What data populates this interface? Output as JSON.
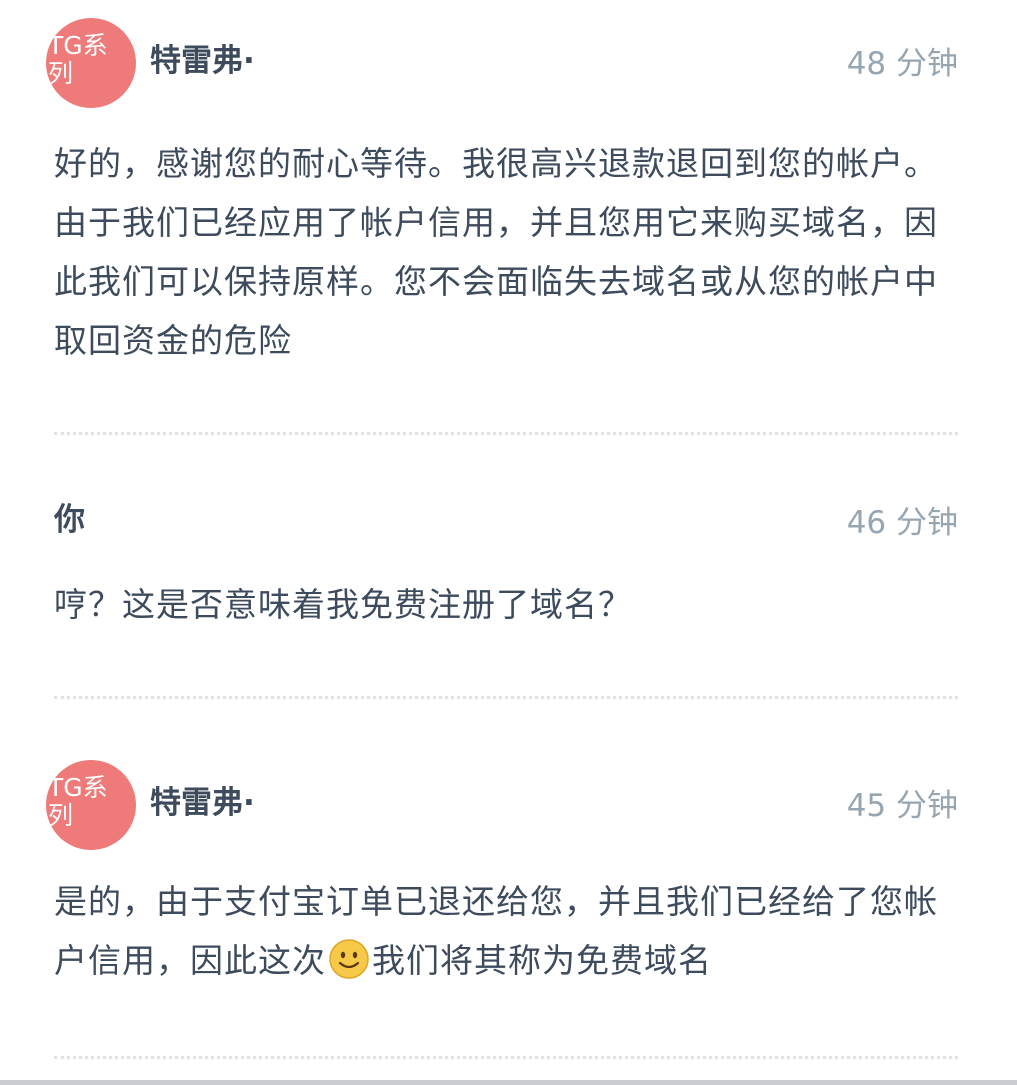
{
  "messages": [
    {
      "author": "特雷弗·",
      "avatar_text": "TG系列",
      "time": "48 分钟",
      "text": "好的，感谢您的耐心等待。我很高兴退款退回到您的帐户。由于我们已经应用了帐户信用，并且您用它来购买域名，因此我们可以保持原样。您不会面临失去域名或从您的帐户中取回资金的危险"
    },
    {
      "author": "你",
      "time": "46 分钟",
      "text": "哼？这是否意味着我免费注册了域名？"
    },
    {
      "author": "特雷弗·",
      "avatar_text": "TG系列",
      "time": "45 分钟",
      "text_before": "是的，由于支付宝订单已退还给您，并且我们已经给了您帐户信用，因此这次",
      "emoji": "slightly-smiling-face-icon",
      "text_after": "我们将其称为免费域名"
    }
  ],
  "colors": {
    "avatar_bg": "#ef7a7a",
    "author_text": "#3d4b5c",
    "time_text": "#97a5b1",
    "divider": "#dfe3e8",
    "emoji_face": "#f7c948"
  }
}
